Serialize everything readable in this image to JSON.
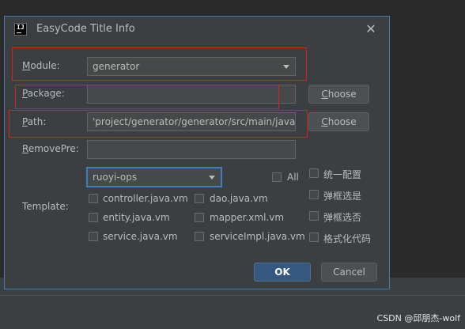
{
  "dialog": {
    "title": "EasyCode Title Info",
    "close_glyph": "✕",
    "app_icon_text": "IJ"
  },
  "form": {
    "module_label_key": "M",
    "module_label_rest": "odule:",
    "module_value": "generator",
    "package_label_key": "P",
    "package_label_rest": "ackage:",
    "package_value": "",
    "path_label_key": "P",
    "path_label_rest": "ath:",
    "path_value": "'project/generator/generator/src/main/java",
    "removepre_label_key": "R",
    "removepre_label_rest": "emovePre:",
    "removepre_value": "",
    "choose_key": "C",
    "choose_rest": "hoose",
    "template_label": "Template:",
    "template_group_value": "ruoyi-ops",
    "all_label": "All"
  },
  "templates": [
    {
      "label": "controller.java.vm",
      "checked": false
    },
    {
      "label": "dao.java.vm",
      "checked": false
    },
    {
      "label": "entity.java.vm",
      "checked": false
    },
    {
      "label": "mapper.xml.vm",
      "checked": false
    },
    {
      "label": "service.java.vm",
      "checked": false
    },
    {
      "label": "serviceImpl.java.vm",
      "checked": false
    }
  ],
  "options": [
    {
      "label": "统一配置",
      "checked": false
    },
    {
      "label": "弹框选是",
      "checked": false
    },
    {
      "label": "弹框选否",
      "checked": false
    },
    {
      "label": "格式化代码",
      "checked": false
    }
  ],
  "buttons": {
    "ok": "OK",
    "cancel": "Cancel"
  },
  "watermark": "CSDN @邱朋杰-wolf"
}
